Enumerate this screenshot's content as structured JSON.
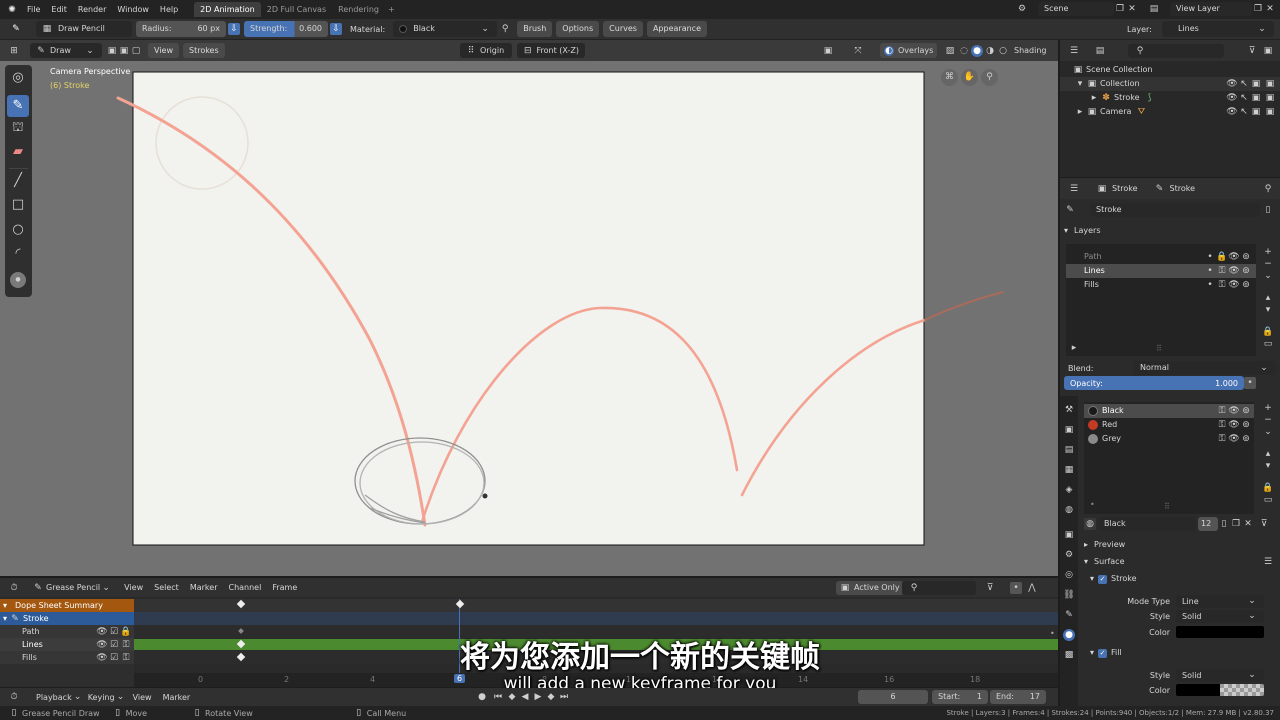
{
  "menubar": {
    "items": [
      "File",
      "Edit",
      "Render",
      "Window",
      "Help"
    ],
    "workspaces": [
      "2D Animation",
      "2D Full Canvas",
      "Rendering"
    ],
    "add_tab": "+",
    "scene": "Scene",
    "view_layer": "View Layer"
  },
  "toolbar": {
    "tool": "Draw Pencil",
    "radius_label": "Radius:",
    "radius_value": "60 px",
    "strength_label": "Strength:",
    "strength_value": "0.600",
    "material_label": "Material:",
    "material_value": "Black",
    "menus": [
      "Brush",
      "Options",
      "Curves",
      "Appearance"
    ],
    "layer_label": "Layer:",
    "layer_value": "Lines"
  },
  "viewport_header": {
    "mode": "Draw",
    "menus": [
      "View",
      "Strokes"
    ],
    "origin": "Origin",
    "view": "Front (X-Z)",
    "overlays": "Overlays",
    "shading": "Shading"
  },
  "viewport": {
    "camera_label": "Camera Perspective",
    "object_label": "(6) Stroke"
  },
  "outliner": {
    "root": "Scene Collection",
    "items": [
      {
        "name": "Collection",
        "depth": 1
      },
      {
        "name": "Stroke",
        "depth": 2
      },
      {
        "name": "Camera",
        "depth": 1
      }
    ]
  },
  "properties": {
    "header_object": "Stroke",
    "header_data": "Stroke",
    "datablock": "Stroke",
    "layers_title": "Layers",
    "layers": [
      "Path",
      "Lines",
      "Fills"
    ],
    "active_layer": "Lines",
    "blend_label": "Blend:",
    "blend_value": "Normal",
    "opacity_label": "Opacity:",
    "opacity_value": "1.000",
    "materials": [
      {
        "name": "Black",
        "color": "#1a1a1a"
      },
      {
        "name": "Red",
        "color": "#c23b22"
      },
      {
        "name": "Grey",
        "color": "#8a8a8a"
      }
    ],
    "material_name": "Black",
    "material_users": "12",
    "preview": "Preview",
    "surface": "Surface",
    "stroke_section": "Stroke",
    "mode_type_label": "Mode Type",
    "mode_type_value": "Line",
    "style_label": "Style",
    "style_value": "Solid",
    "color_label": "Color",
    "stroke_color": "#000000",
    "fill_section": "Fill",
    "fill_style_value": "Solid"
  },
  "dopesheet": {
    "mode": "Grease Pencil",
    "menus": [
      "View",
      "Select",
      "Marker",
      "Channel",
      "Frame"
    ],
    "active_only": "Active Only",
    "channels": [
      {
        "name": "Dope Sheet Summary",
        "type": "summary"
      },
      {
        "name": "Stroke",
        "type": "object"
      },
      {
        "name": "Path",
        "type": "layer"
      },
      {
        "name": "Lines",
        "type": "layer"
      },
      {
        "name": "Fills",
        "type": "layer"
      }
    ],
    "ruler": [
      "0",
      "2",
      "4",
      "6",
      "8",
      "10",
      "12",
      "14",
      "16",
      "18"
    ],
    "current_frame": "6",
    "keyframes_at": [
      1,
      6
    ]
  },
  "timeline": {
    "menus": [
      "Playback",
      "Keying",
      "View",
      "Marker"
    ],
    "frame": "6",
    "start_label": "Start:",
    "start": "1",
    "end_label": "End:",
    "end": "17"
  },
  "subtitle": {
    "zh": "将为您添加一个新的关键帧",
    "en": "will add a new keyframe for you"
  },
  "statusbar": {
    "left": [
      "Grease Pencil Draw",
      "Move",
      "Rotate View",
      "Call Menu"
    ],
    "right": "Stroke | Layers:3 | Frames:4 | Strokes:24 | Points:940 | Objects:1/2 | Mem: 27.9 MB | v2.80.37"
  },
  "colors": {
    "accent": "#4772b3",
    "canvas": "#f2f2ee",
    "path_stroke": "#f2a08e",
    "keyframe_row": "#4c8a2f"
  }
}
